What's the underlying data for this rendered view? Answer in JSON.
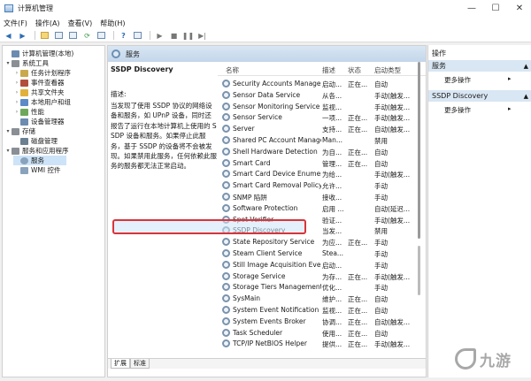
{
  "window": {
    "title": "计算机管理",
    "controls": {
      "minimize": "—",
      "maximize": "☐",
      "close": "✕"
    }
  },
  "menu": [
    "文件(F)",
    "操作(A)",
    "查看(V)",
    "帮助(H)"
  ],
  "tree": [
    {
      "label": "计算机管理(本地)",
      "icon": "computer-icon",
      "color": "#6c8bb0",
      "arrow": "",
      "level": 0,
      "selected": false
    },
    {
      "label": "系统工具",
      "icon": "tools-icon",
      "color": "#8a8f96",
      "arrow": "▾",
      "level": 1,
      "selected": false
    },
    {
      "label": "任务计划程序",
      "icon": "clock-icon",
      "color": "#c9a94d",
      "arrow": "›",
      "level": 2,
      "selected": false
    },
    {
      "label": "事件查看器",
      "icon": "event-viewer-icon",
      "color": "#b14e3c",
      "arrow": "›",
      "level": 2,
      "selected": false
    },
    {
      "label": "共享文件夹",
      "icon": "folder-icon",
      "color": "#e2b13c",
      "arrow": "›",
      "level": 2,
      "selected": false
    },
    {
      "label": "本地用户和组",
      "icon": "users-icon",
      "color": "#5b8ac7",
      "arrow": "›",
      "level": 2,
      "selected": false
    },
    {
      "label": "性能",
      "icon": "performance-icon",
      "color": "#6ea85b",
      "arrow": "›",
      "level": 2,
      "selected": false
    },
    {
      "label": "设备管理器",
      "icon": "device-manager-icon",
      "color": "#6c8bb0",
      "arrow": "",
      "level": 2,
      "selected": false
    },
    {
      "label": "存储",
      "icon": "storage-icon",
      "color": "#8a8f96",
      "arrow": "▾",
      "level": 1,
      "selected": false
    },
    {
      "label": "磁盘管理",
      "icon": "disk-icon",
      "color": "#6b8090",
      "arrow": "",
      "level": 2,
      "selected": false
    },
    {
      "label": "服务和应用程序",
      "icon": "services-apps-icon",
      "color": "#8a8f96",
      "arrow": "▾",
      "level": 1,
      "selected": false
    },
    {
      "label": "服务",
      "icon": "gear-icon",
      "color": "#8aa3bc",
      "arrow": "",
      "level": 2,
      "selected": true
    },
    {
      "label": "WMI 控件",
      "icon": "wmi-icon",
      "color": "#8aa3bc",
      "arrow": "",
      "level": 2,
      "selected": false
    }
  ],
  "center": {
    "header": "服务",
    "service_name": "SSDP Discovery",
    "desc_label": "描述:",
    "desc_text": "当发现了使用 SSDP 协议的网络设备和服务，如 UPnP 设备，同时还报告了运行在本地计算机上使用的 SSDP 设备和服务。如果停止此服务，基于 SSDP 的设备将不会被发现。如果禁用此服务，任何依赖此服务的服务都无法正常启动。",
    "columns": {
      "name": "名称",
      "desc": "描述",
      "status": "状态",
      "startup": "启动类型"
    },
    "tabs": [
      "扩展",
      "标准"
    ]
  },
  "services": [
    {
      "name": "Security Accounts Manager",
      "desc": "启动...",
      "status": "正在...",
      "startup": "自动"
    },
    {
      "name": "Sensor Data Service",
      "desc": "从各...",
      "status": "",
      "startup": "手动(触发..."
    },
    {
      "name": "Sensor Monitoring Service",
      "desc": "监视...",
      "status": "",
      "startup": "手动(触发..."
    },
    {
      "name": "Sensor Service",
      "desc": "一项...",
      "status": "正在...",
      "startup": "手动(触发..."
    },
    {
      "name": "Server",
      "desc": "支持...",
      "status": "正在...",
      "startup": "自动(触发..."
    },
    {
      "name": "Shared PC Account Manager",
      "desc": "Man...",
      "status": "",
      "startup": "禁用"
    },
    {
      "name": "Shell Hardware Detection",
      "desc": "为自...",
      "status": "正在...",
      "startup": "自动"
    },
    {
      "name": "Smart Card",
      "desc": "管理...",
      "status": "正在...",
      "startup": "自动"
    },
    {
      "name": "Smart Card Device Enumer...",
      "desc": "为给...",
      "status": "",
      "startup": "手动(触发..."
    },
    {
      "name": "Smart Card Removal Policy",
      "desc": "允许...",
      "status": "",
      "startup": "手动"
    },
    {
      "name": "SNMP 陷阱",
      "desc": "接收...",
      "status": "",
      "startup": "手动"
    },
    {
      "name": "Software Protection",
      "desc": "启用 ...",
      "status": "",
      "startup": "自动(延迟..."
    },
    {
      "name": "Spot Verifier",
      "desc": "验证...",
      "status": "",
      "startup": "手动(触发..."
    },
    {
      "name": "SSDP Discovery",
      "desc": "当发...",
      "status": "",
      "startup": "禁用"
    },
    {
      "name": "State Repository Service",
      "desc": "为应...",
      "status": "正在...",
      "startup": "手动"
    },
    {
      "name": "Steam Client Service",
      "desc": "Stea...",
      "status": "",
      "startup": "手动"
    },
    {
      "name": "Still Image Acquisition Eve...",
      "desc": "启动...",
      "status": "",
      "startup": "手动"
    },
    {
      "name": "Storage Service",
      "desc": "为存...",
      "status": "正在...",
      "startup": "手动(触发..."
    },
    {
      "name": "Storage Tiers Management",
      "desc": "优化...",
      "status": "",
      "startup": "手动"
    },
    {
      "name": "SysMain",
      "desc": "维护...",
      "status": "正在...",
      "startup": "自动"
    },
    {
      "name": "System Event Notification ...",
      "desc": "监视...",
      "status": "正在...",
      "startup": "自动"
    },
    {
      "name": "System Events Broker",
      "desc": "协调...",
      "status": "正在...",
      "startup": "自动(触发..."
    },
    {
      "name": "Task Scheduler",
      "desc": "使用...",
      "status": "正在...",
      "startup": "自动"
    },
    {
      "name": "TCP/IP NetBIOS Helper",
      "desc": "提供...",
      "status": "正在...",
      "startup": "手动(触发..."
    }
  ],
  "actions": {
    "title": "操作",
    "groups": [
      {
        "header": "服务",
        "item": "更多操作"
      },
      {
        "header": "SSDP Discovery",
        "item": "更多操作"
      }
    ]
  },
  "watermark": "九游"
}
